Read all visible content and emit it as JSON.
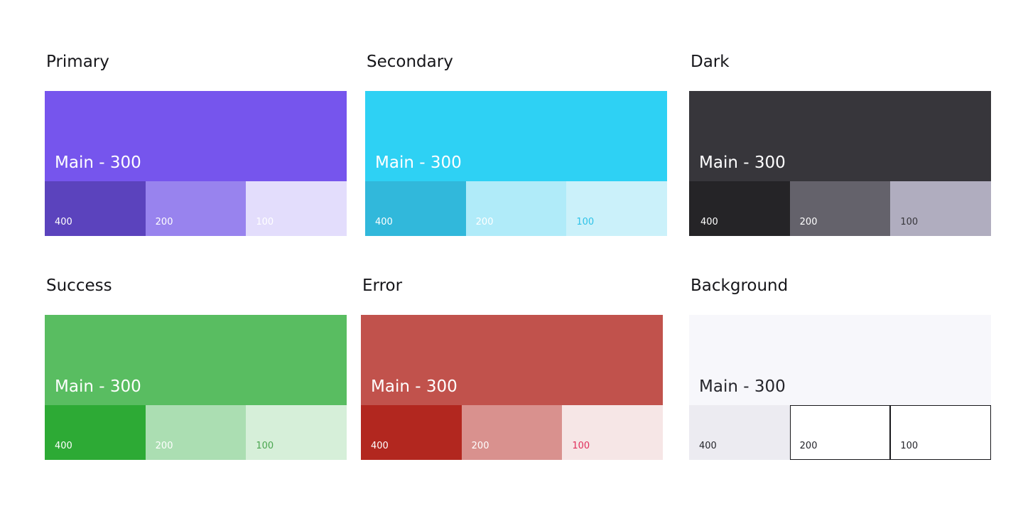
{
  "palettes": [
    {
      "title": "Primary",
      "main": {
        "label": "Main - 300",
        "bg": "#7655ed",
        "fg": "#ffffff"
      },
      "shades": [
        {
          "label": "400",
          "bg": "#5b43bd",
          "fg": "#ffffff"
        },
        {
          "label": "200",
          "bg": "#9883ee",
          "fg": "#ffffff"
        },
        {
          "label": "100",
          "bg": "#e3ddfc",
          "fg": "#ffffff"
        }
      ]
    },
    {
      "title": "Secondary",
      "main": {
        "label": "Main - 300",
        "bg": "#2ed1f4",
        "fg": "#ffffff"
      },
      "shades": [
        {
          "label": "400",
          "bg": "#31b8db",
          "fg": "#ffffff"
        },
        {
          "label": "200",
          "bg": "#b0ebf9",
          "fg": "#ffffff"
        },
        {
          "label": "100",
          "bg": "#cbf1fa",
          "fg": "#2ec3e8"
        }
      ]
    },
    {
      "title": "Dark",
      "main": {
        "label": "Main - 300",
        "bg": "#37363b",
        "fg": "#ffffff"
      },
      "shades": [
        {
          "label": "400",
          "bg": "#252427",
          "fg": "#ffffff"
        },
        {
          "label": "200",
          "bg": "#64626b",
          "fg": "#ffffff"
        },
        {
          "label": "100",
          "bg": "#b0adbf",
          "fg": "#37363b"
        }
      ]
    },
    {
      "title": "Success",
      "main": {
        "label": "Main - 300",
        "bg": "#59bd61",
        "fg": "#ffffff"
      },
      "shades": [
        {
          "label": "400",
          "bg": "#2daa35",
          "fg": "#ffffff"
        },
        {
          "label": "200",
          "bg": "#abdeb2",
          "fg": "#ffffff"
        },
        {
          "label": "100",
          "bg": "#d6efd9",
          "fg": "#4aa650"
        }
      ]
    },
    {
      "title": "Error",
      "main": {
        "label": "Main - 300",
        "bg": "#c1524c",
        "fg": "#ffffff"
      },
      "shades": [
        {
          "label": "400",
          "bg": "#b2271f",
          "fg": "#ffffff"
        },
        {
          "label": "200",
          "bg": "#d9918e",
          "fg": "#ffffff"
        },
        {
          "label": "100",
          "bg": "#f6e6e6",
          "fg": "#e0305c"
        }
      ]
    },
    {
      "title": "Background",
      "main": {
        "label": "Main - 300",
        "bg": "#f7f7fb",
        "fg": "#25252b"
      },
      "shades": [
        {
          "label": "400",
          "bg": "#ecebf1",
          "fg": "#25252b"
        },
        {
          "label": "200",
          "bg": "#ffffff",
          "fg": "#25252b",
          "outlined": true
        },
        {
          "label": "100",
          "bg": "#ffffff",
          "fg": "#25252b",
          "outlined": true
        }
      ]
    }
  ]
}
